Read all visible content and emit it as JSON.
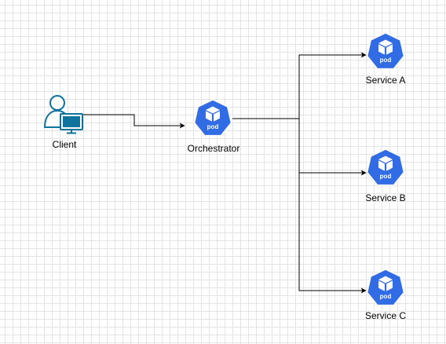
{
  "nodes": {
    "client": {
      "label": "Client"
    },
    "orchestrator": {
      "label": "Orchestrator",
      "badge": "pod"
    },
    "service_a": {
      "label": "Service A",
      "badge": "pod"
    },
    "service_b": {
      "label": "Service B",
      "badge": "pod"
    },
    "service_c": {
      "label": "Service C",
      "badge": "pod"
    }
  },
  "edges": [
    {
      "from": "client",
      "to": "orchestrator"
    },
    {
      "from": "orchestrator",
      "to": "service_a"
    },
    {
      "from": "orchestrator",
      "to": "service_b"
    },
    {
      "from": "orchestrator",
      "to": "service_c"
    }
  ],
  "colors": {
    "pod": "#326ce5",
    "client_icon": "#10739e",
    "edge": "#000000",
    "grid": "#e4e4e4"
  },
  "icons": {
    "client": "user-computer-icon",
    "pod": "kubernetes-pod-icon"
  }
}
